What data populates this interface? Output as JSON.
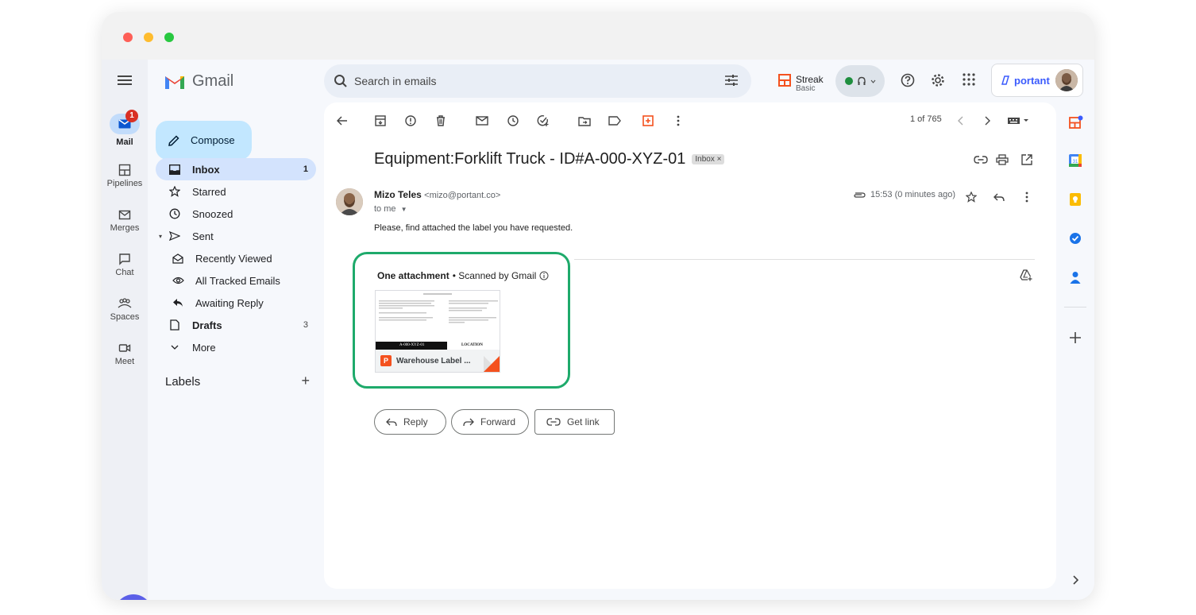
{
  "app": {
    "name": "Gmail"
  },
  "rail": {
    "items": [
      {
        "label": "Mail",
        "badge": "1"
      },
      {
        "label": "Pipelines"
      },
      {
        "label": "Merges"
      },
      {
        "label": "Chat"
      },
      {
        "label": "Spaces"
      },
      {
        "label": "Meet"
      }
    ]
  },
  "sidebar": {
    "compose_label": "Compose",
    "items": [
      {
        "label": "Inbox",
        "count": "1"
      },
      {
        "label": "Starred",
        "count": ""
      },
      {
        "label": "Snoozed",
        "count": ""
      },
      {
        "label": "Sent",
        "count": ""
      },
      {
        "label": "Recently Viewed",
        "count": ""
      },
      {
        "label": "All Tracked Emails",
        "count": ""
      },
      {
        "label": "Awaiting Reply",
        "count": ""
      },
      {
        "label": "Drafts",
        "count": "3"
      },
      {
        "label": "More",
        "count": ""
      }
    ],
    "labels_heading": "Labels",
    "labels_add": "+"
  },
  "search": {
    "placeholder": "Search in emails"
  },
  "streak": {
    "name": "Streak",
    "plan": "Basic"
  },
  "portant": {
    "label": "portant"
  },
  "toolbar": {
    "pager": "1 of 765"
  },
  "email": {
    "subject": "Equipment:Forklift Truck - ID#A-000-XYZ-01",
    "label_chip": "Inbox ×",
    "sender_name": "Mizo Teles",
    "sender_email": "<mizo@portant.co>",
    "to": "to me",
    "time": "15:53 (0 minutes ago)",
    "body": "Please, find attached the label you have requested."
  },
  "attachment": {
    "title": "One attachment",
    "scan": "• Scanned by Gmail",
    "file_name": "Warehouse Label ...",
    "file_type": "P",
    "preview_left": "A-000-XYZ-01",
    "preview_right": "LOCATION"
  },
  "actions": {
    "reply": "Reply",
    "forward": "Forward",
    "get_link": "Get link"
  },
  "colors": {
    "attachment_highlight": "#1eaa6b",
    "compose_bg": "#c2e7ff",
    "active_nav": "#d3e3fd",
    "fab": "#5b5fe8"
  }
}
